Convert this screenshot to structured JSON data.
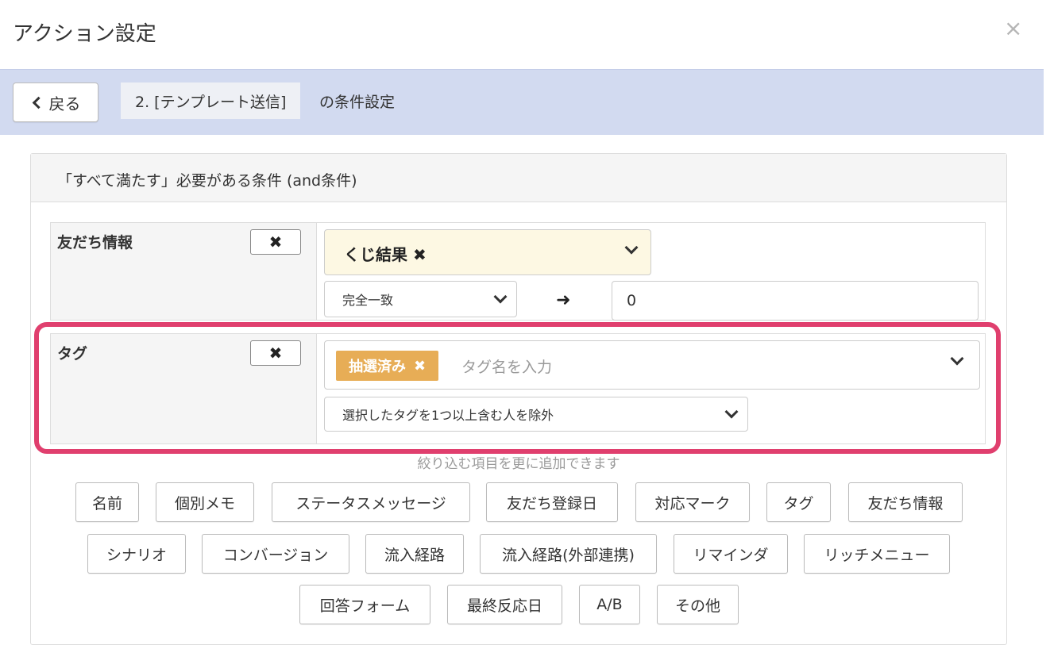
{
  "modal": {
    "title": "アクション設定",
    "close_glyph": "×"
  },
  "subbar": {
    "back_label": "戻る",
    "crumb": "2. [テンプレート送信]",
    "crumb_suffix": "の条件設定"
  },
  "panel": {
    "title": "「すべて満たす」必要がある条件 (and条件)"
  },
  "conditions": {
    "friend_info": {
      "label": "友だち情報",
      "remove_glyph": "✖",
      "field_chip": "くじ結果 ✖",
      "match_mode": "完全一致",
      "arrow_glyph": "➜",
      "value": "0"
    },
    "tag": {
      "label": "タグ",
      "remove_glyph": "✖",
      "chip_label": "抽選済み",
      "chip_remove": "✖",
      "placeholder": "タグ名を入力",
      "mode": "選択したタグを1つ以上含む人を除外"
    }
  },
  "add_hint": "絞り込む項目を更に追加できます",
  "filter_buttons": {
    "b1": "名前",
    "b2": "個別メモ",
    "b3": "ステータスメッセージ",
    "b4": "友だち登録日",
    "b5": "対応マーク",
    "b6": "タグ",
    "b7": "友だち情報",
    "b8": "シナリオ",
    "b9": "コンバージョン",
    "b10": "流入経路",
    "b11": "流入経路(外部連携)",
    "b12": "リマインダ",
    "b13": "リッチメニュー",
    "b14": "回答フォーム",
    "b15": "最終反応日",
    "b16": "A/B",
    "b17": "その他"
  },
  "colors": {
    "subbar": "#d2daf0",
    "highlight": "#e03f6e",
    "tag_chip": "#e7ad56",
    "field_select": "#fdf8e3"
  }
}
